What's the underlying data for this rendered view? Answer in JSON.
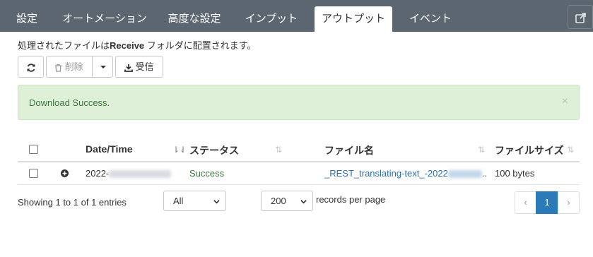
{
  "tabs": [
    {
      "label": "設定"
    },
    {
      "label": "オートメーション"
    },
    {
      "label": "高度な設定"
    },
    {
      "label": "インプット"
    },
    {
      "label": "アウトプット"
    },
    {
      "label": "イベント"
    }
  ],
  "active_tab": "アウトプット",
  "description": {
    "before": "処理されたファイルは",
    "folder": "Receive",
    "after": " フォルダに配置されます。"
  },
  "toolbar": {
    "refresh_icon": "refresh-icon",
    "delete_label": "削除",
    "receive_label": "受信"
  },
  "alert": {
    "message": "Download Success.",
    "close": "×",
    "color": "#dff0d8"
  },
  "table": {
    "columns": [
      "Date/Time",
      "ステータス",
      "ファイル名",
      "ファイルサイズ"
    ],
    "rows": [
      {
        "datetime": "2022-",
        "status": "Success",
        "filename": "_REST_translating-text_-2022",
        "filename_suffix": "..",
        "filesize": "100 bytes"
      }
    ]
  },
  "footer": {
    "info": "Showing 1 to 1 of 1 entries",
    "filter_value": "All",
    "page_size_value": "200",
    "records_per_page": "records per page"
  },
  "pagination": {
    "prev": "‹",
    "current": "1",
    "next": "›",
    "accent": "#2a7ab8"
  }
}
